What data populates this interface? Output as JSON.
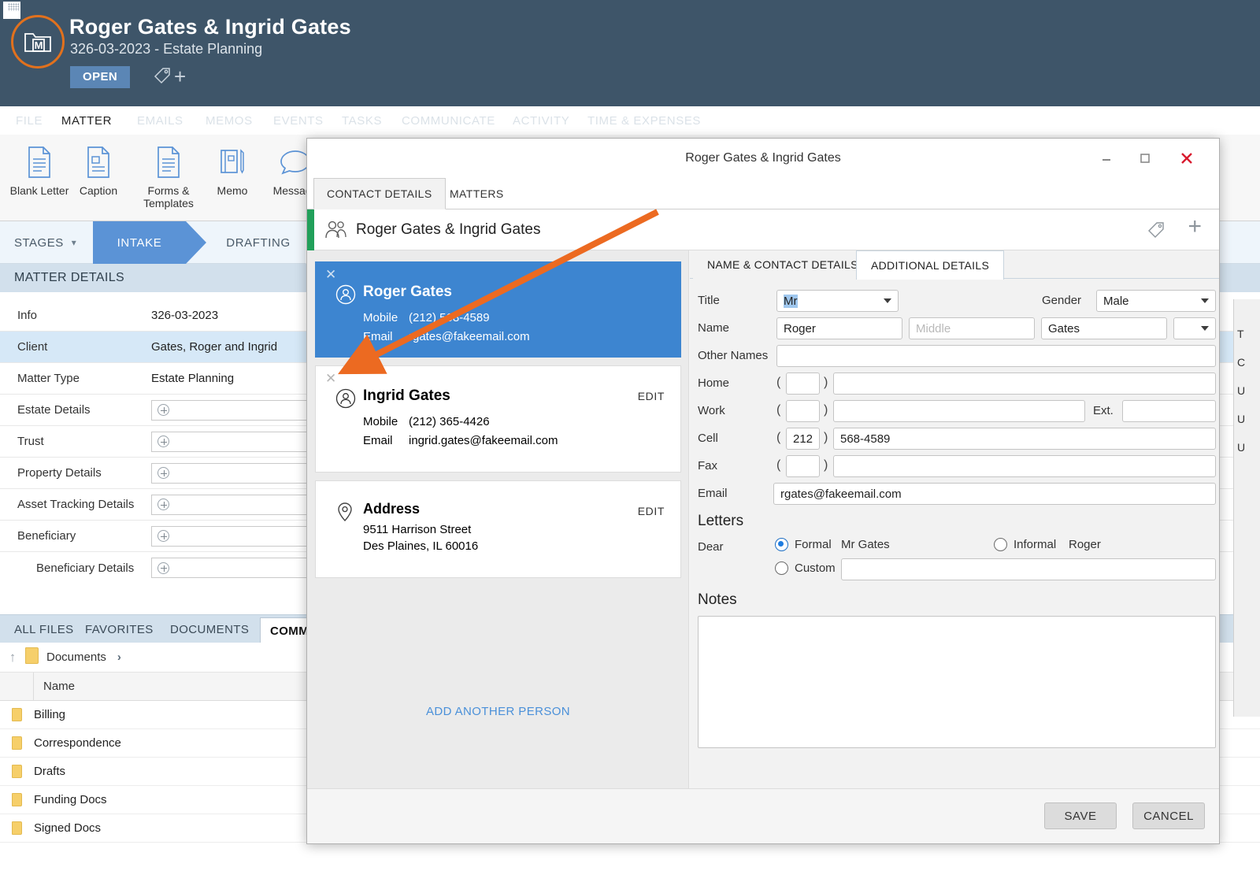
{
  "app": {
    "title": "Roger Gates & Ingrid Gates",
    "subtitle": "326-03-2023 - Estate Planning",
    "status_badge": "OPEN",
    "matter_icon": "matter-folder-icon",
    "tag_icon": "tag-icon",
    "plus_icon": "plus-icon",
    "accent_orange": "#e2711d",
    "header_bg": "#3e5569"
  },
  "nav": {
    "tabs": [
      {
        "label": "FILE",
        "active": false
      },
      {
        "label": "MATTER",
        "active": true
      },
      {
        "label": "EMAILS",
        "active": false
      },
      {
        "label": "MEMOS",
        "active": false
      },
      {
        "label": "EVENTS",
        "active": false
      },
      {
        "label": "TASKS",
        "active": false
      },
      {
        "label": "COMMUNICATE",
        "active": false
      },
      {
        "label": "ACTIVITY",
        "active": false
      },
      {
        "label": "TIME & EXPENSES",
        "active": false
      }
    ]
  },
  "ribbon": {
    "buttons": [
      {
        "label": "Blank Letter",
        "icon": "document-lines-icon"
      },
      {
        "label": "Caption",
        "icon": "document-caption-icon"
      },
      {
        "label": "Forms & Templates",
        "icon": "document-forms-icon"
      },
      {
        "label": "Memo",
        "icon": "memo-pen-icon"
      },
      {
        "label": "Message",
        "icon": "speech-bubble-icon"
      }
    ]
  },
  "stages": {
    "label": "STAGES",
    "chips": [
      {
        "label": "INTAKE",
        "active": true
      },
      {
        "label": "DRAFTING",
        "active": false
      }
    ]
  },
  "matter_details": {
    "header": "MATTER DETAILS",
    "rows": [
      {
        "key": "Info",
        "value": "326-03-2023",
        "type": "text",
        "selected": false,
        "indent": false
      },
      {
        "key": "Client",
        "value": "Gates, Roger and Ingrid",
        "type": "text",
        "selected": true,
        "indent": false
      },
      {
        "key": "Matter Type",
        "value": "Estate Planning",
        "type": "text",
        "selected": false,
        "indent": false
      },
      {
        "key": "Estate Details",
        "value": "",
        "type": "add",
        "selected": false,
        "indent": false
      },
      {
        "key": "Trust",
        "value": "",
        "type": "add",
        "selected": false,
        "indent": false
      },
      {
        "key": "Property Details",
        "value": "",
        "type": "add",
        "selected": false,
        "indent": false
      },
      {
        "key": "Asset Tracking Details",
        "value": "",
        "type": "add",
        "selected": false,
        "indent": false
      },
      {
        "key": "Beneficiary",
        "value": "",
        "type": "add",
        "selected": false,
        "indent": false
      },
      {
        "key": "Beneficiary Details",
        "value": "",
        "type": "add",
        "selected": false,
        "indent": true
      }
    ]
  },
  "files": {
    "tabs": [
      {
        "label": "ALL FILES",
        "active": false
      },
      {
        "label": "FAVORITES",
        "active": false
      },
      {
        "label": "DOCUMENTS",
        "active": false
      },
      {
        "label": "COMMUNICATIONS",
        "active": true
      }
    ],
    "breadcrumb": {
      "up_icon": "arrow-up-icon",
      "folder": "Documents",
      "chevron": "›"
    },
    "column_header": "Name",
    "rows": [
      {
        "name": "Billing",
        "icon": "folder-icon"
      },
      {
        "name": "Correspondence",
        "icon": "folder-icon"
      },
      {
        "name": "Drafts",
        "icon": "folder-icon"
      },
      {
        "name": "Funding Docs",
        "icon": "folder-icon"
      },
      {
        "name": "Signed Docs",
        "icon": "folder-icon"
      }
    ]
  },
  "dialog": {
    "title": "Roger Gates & Ingrid Gates",
    "window_controls": {
      "minimize": "minimize-icon",
      "maximize": "maximize-icon",
      "close": "close-icon"
    },
    "tabs": [
      {
        "label": "CONTACT DETAILS",
        "active": true
      },
      {
        "label": "MATTERS",
        "active": false
      }
    ],
    "subheader": {
      "name": "Roger Gates & Ingrid Gates",
      "people_icon": "people-icon",
      "tag_icon": "tag-icon",
      "plus_icon": "plus-icon",
      "accent_green": "#21a05a"
    },
    "people": [
      {
        "name": "Roger Gates",
        "mobile_label": "Mobile",
        "mobile": "(212) 568-4589",
        "email_label": "Email",
        "email": "rgates@fakeemail.com",
        "selected": true,
        "edit_label": "",
        "avatar_icon": "person-circle-icon",
        "remove_icon": "close-icon"
      },
      {
        "name": "Ingrid Gates",
        "mobile_label": "Mobile",
        "mobile": "(212) 365-4426",
        "email_label": "Email",
        "email": "ingrid.gates@fakeemail.com",
        "selected": false,
        "edit_label": "EDIT",
        "avatar_icon": "person-circle-icon",
        "remove_icon": "close-icon"
      }
    ],
    "address": {
      "title": "Address",
      "edit_label": "EDIT",
      "line1": "9511 Harrison Street",
      "line2": "Des Plaines, IL 60016",
      "pin_icon": "map-pin-icon"
    },
    "add_another_person": "ADD ANOTHER PERSON",
    "form": {
      "tabs": [
        {
          "label": "NAME & CONTACT DETAILS",
          "active": true
        },
        {
          "label": "ADDITIONAL DETAILS",
          "active": false
        }
      ],
      "title_label": "Title",
      "title_value": "Mr",
      "gender_label": "Gender",
      "gender_value": "Male",
      "name_label": "Name",
      "first_name": "Roger",
      "middle_placeholder": "Middle",
      "middle_name": "",
      "last_name": "Gates",
      "suffix_value": "",
      "other_names_label": "Other Names",
      "other_names": "",
      "home_label": "Home",
      "home_area": "",
      "home_number": "",
      "work_label": "Work",
      "work_area": "",
      "work_number": "",
      "ext_label": "Ext.",
      "ext_value": "",
      "cell_label": "Cell",
      "cell_area": "212",
      "cell_number": "568-4589",
      "fax_label": "Fax",
      "fax_area": "",
      "fax_number": "",
      "email_label": "Email",
      "email_value": "rgates@fakeemail.com",
      "letters_header": "Letters",
      "dear_label": "Dear",
      "formal_label": "Formal",
      "formal_value": "Mr Gates",
      "formal_selected": true,
      "informal_label": "Informal",
      "informal_value": "Roger",
      "informal_selected": false,
      "custom_label": "Custom",
      "custom_value": "",
      "custom_selected": false,
      "notes_header": "Notes",
      "notes_value": ""
    },
    "footer": {
      "save_label": "SAVE",
      "cancel_label": "CANCEL"
    }
  },
  "edge_panel": {
    "letters": [
      "T",
      "C",
      "U",
      "U",
      "U"
    ]
  },
  "annotation": {
    "arrow_color": "#ec6a21",
    "description": "arrow-annotation"
  }
}
